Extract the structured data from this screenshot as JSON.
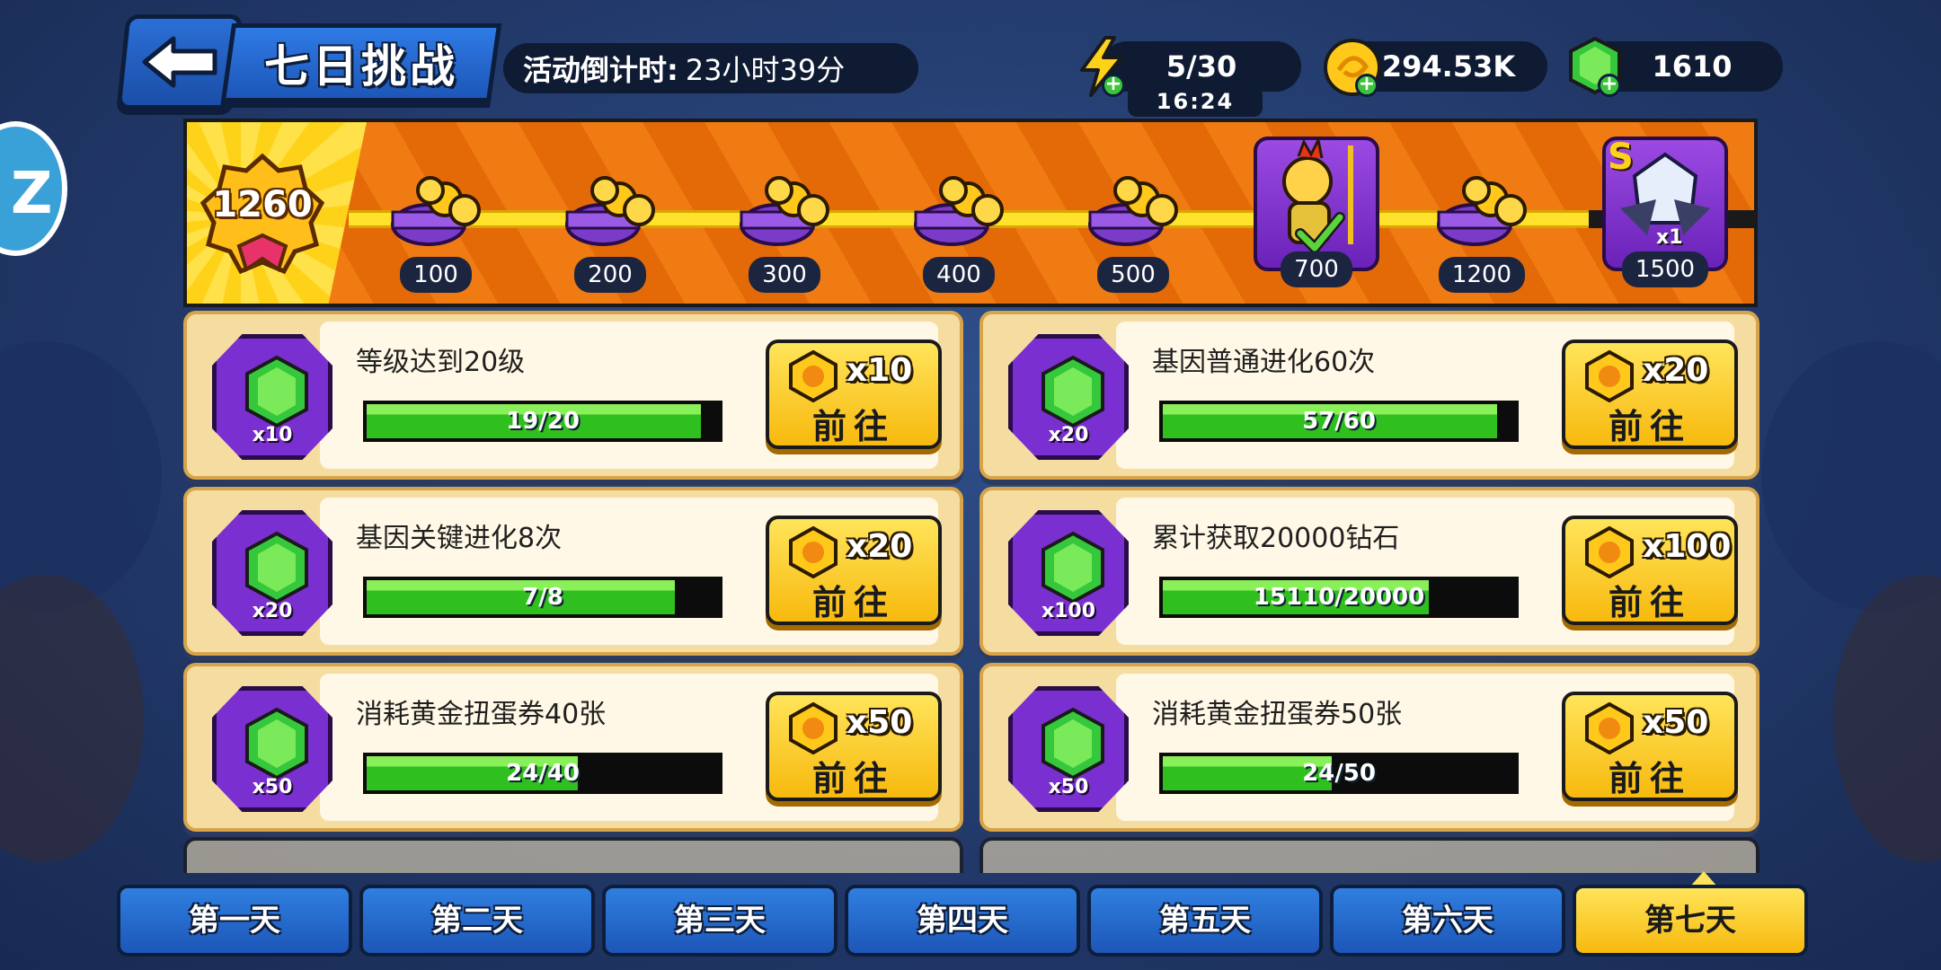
{
  "header": {
    "back_icon": "back-arrow-icon",
    "title": "七日挑战",
    "countdown_label": "活动倒计时:",
    "countdown_value": "23小时39分"
  },
  "resources": {
    "energy": {
      "icon": "lightning-icon",
      "value": "5/30",
      "timer": "16:24"
    },
    "gold": {
      "icon": "gold-coin-icon",
      "value": "294.53K"
    },
    "gems": {
      "icon": "green-gem-icon",
      "value": "1610"
    }
  },
  "progress_track": {
    "current_points": "1260",
    "milestones": [
      {
        "label": "100",
        "reward": "chest"
      },
      {
        "label": "200",
        "reward": "chest"
      },
      {
        "label": "300",
        "reward": "chest"
      },
      {
        "label": "400",
        "reward": "chest"
      },
      {
        "label": "500",
        "reward": "chest"
      },
      {
        "label": "700",
        "reward": "hero-rooster",
        "claimed": true
      },
      {
        "label": "1200",
        "reward": "chest"
      },
      {
        "label": "1500",
        "reward": "hero-mech",
        "badge": "S",
        "count": "x1"
      }
    ]
  },
  "tasks": [
    {
      "title": "等级达到20级",
      "gem_reward": "x10",
      "progress_text": "19/20",
      "progress": 0.95,
      "point_reward": "x10",
      "button": "前往"
    },
    {
      "title": "基因普通进化60次",
      "gem_reward": "x20",
      "progress_text": "57/60",
      "progress": 0.95,
      "point_reward": "x20",
      "button": "前往"
    },
    {
      "title": "基因关键进化8次",
      "gem_reward": "x20",
      "progress_text": "7/8",
      "progress": 0.875,
      "point_reward": "x20",
      "button": "前往"
    },
    {
      "title": "累计获取20000钻石",
      "gem_reward": "x100",
      "progress_text": "15110/20000",
      "progress": 0.7555,
      "point_reward": "x100",
      "button": "前往"
    },
    {
      "title": "消耗黄金扭蛋券40张",
      "gem_reward": "x50",
      "progress_text": "24/40",
      "progress": 0.6,
      "point_reward": "x50",
      "button": "前往"
    },
    {
      "title": "消耗黄金扭蛋券50张",
      "gem_reward": "x50",
      "progress_text": "24/50",
      "progress": 0.48,
      "point_reward": "x50",
      "button": "前往"
    }
  ],
  "days": [
    "第一天",
    "第二天",
    "第三天",
    "第四天",
    "第五天",
    "第六天",
    "第七天"
  ],
  "active_day": 6,
  "colors": {
    "accent_yellow": "#ffd21a",
    "tab_blue": "#2f7fe0",
    "gem_green": "#35c83c",
    "card_purple": "#7a2fd0"
  }
}
